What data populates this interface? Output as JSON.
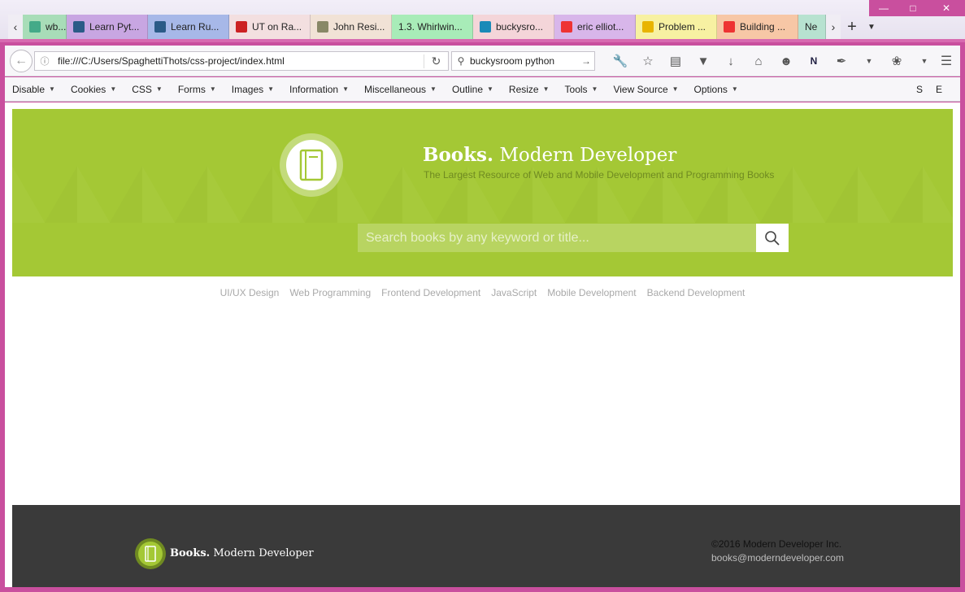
{
  "browser": {
    "tabs": [
      {
        "label": "wb...",
        "color": "#a8ddb8",
        "fav": "#4a8"
      },
      {
        "label": "Learn Pyt...",
        "color": "#c8a6e2",
        "fav": "#2b5b87"
      },
      {
        "label": "Learn Ru...",
        "color": "#a7b8e8",
        "fav": "#2b5b87"
      },
      {
        "label": "UT on Ra...",
        "color": "#f3dfe0",
        "fav": "#c22"
      },
      {
        "label": "John Resi...",
        "color": "#f1e2d6",
        "fav": "#886"
      },
      {
        "label": "1.3. Whirlwin...",
        "color": "#a8ecb8",
        "fav": ""
      },
      {
        "label": "buckysro...",
        "color": "#f4d5d9",
        "fav": "#1a8ab8"
      },
      {
        "label": "eric elliot...",
        "color": "#d8b6ea",
        "fav": "#e33"
      },
      {
        "label": "Problem ...",
        "color": "#f7f1a2",
        "fav": "#e8b400"
      },
      {
        "label": "Building ...",
        "color": "#f7c7a6",
        "fav": "#e33"
      },
      {
        "label": "Ne",
        "color": "#b7e2d0",
        "fav": ""
      }
    ],
    "url": "file:///C:/Users/SpaghettiThots/css-project/index.html",
    "search_value": "buckysroom python"
  },
  "devbar": {
    "menus": [
      "Disable",
      "Cookies",
      "CSS",
      "Forms",
      "Images",
      "Information",
      "Miscellaneous",
      "Outline",
      "Resize",
      "Tools",
      "View Source",
      "Options"
    ],
    "right": [
      "S",
      "E"
    ]
  },
  "page": {
    "brand_bold": "Books.",
    "brand_rest": " Modern Developer",
    "tagline": "The Largest Resource of Web and Mobile Development and Programming Books",
    "search_placeholder": "Search books by any keyword or title...",
    "categories": [
      "UI/UX Design",
      "Web Programming",
      "Frontend Development",
      "JavaScript",
      "Mobile Development",
      "Backend Development"
    ],
    "footer": {
      "brand_bold": "Books.",
      "brand_rest": " Modern Developer",
      "copyright": "©2016 Modern Developer Inc.",
      "email": "books@moderndeveloper.com"
    },
    "accent": "#a4c835",
    "footer_bg": "#3a3a3a"
  }
}
